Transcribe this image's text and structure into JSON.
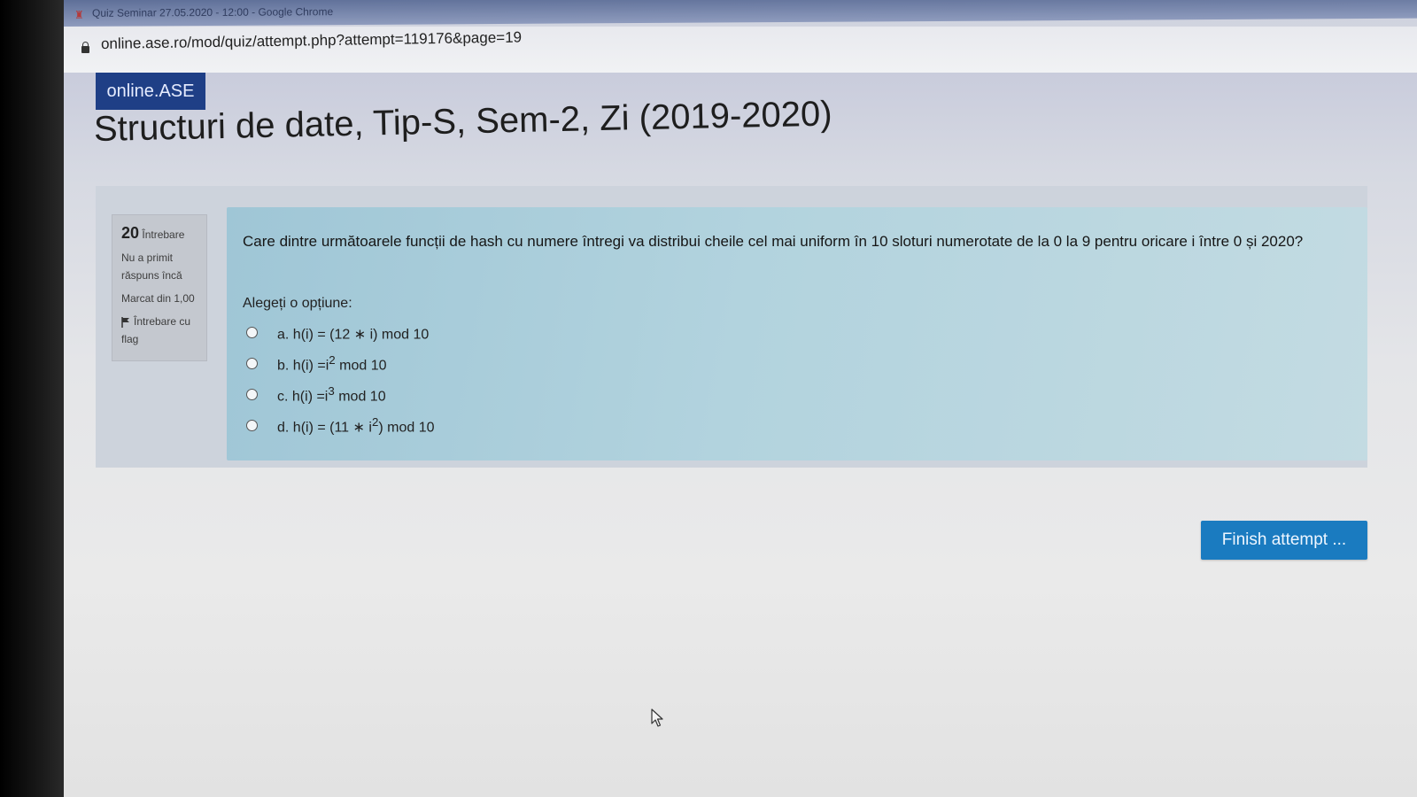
{
  "browser": {
    "window_title": "Quiz Seminar 27.05.2020 - 12:00 - Google Chrome",
    "url": "online.ase.ro/mod/quiz/attempt.php?attempt=119176&page=19"
  },
  "header": {
    "brand": "online.ASE",
    "course_title": "Structuri de date, Tip-S, Sem-2, Zi (2019-2020)"
  },
  "question_info": {
    "number": "20",
    "label": "Întrebare",
    "status": "Nu a primit răspuns încă",
    "marks": "Marcat din 1,00",
    "flag_label": "Întrebare cu flag"
  },
  "question": {
    "text": "Care dintre următoarele funcții de hash cu numere întregi va distribui cheile cel mai uniform în 10 sloturi numerotate de la 0 la 9 pentru oricare i între 0 și 2020?",
    "prompt": "Alegeți o opțiune:",
    "options": [
      {
        "letter": "a.",
        "pre": "h(i) = (12 ∗ i) mod 10",
        "sup": "",
        "post": ""
      },
      {
        "letter": "b.",
        "pre": "h(i) =i",
        "sup": "2",
        "post": " mod 10"
      },
      {
        "letter": "c.",
        "pre": "h(i) =i",
        "sup": "3",
        "post": " mod 10"
      },
      {
        "letter": "d.",
        "pre": "h(i) = (11 ∗ i",
        "sup": "2",
        "post": ") mod 10"
      }
    ]
  },
  "actions": {
    "finish_label": "Finish attempt ..."
  },
  "colors": {
    "brand_bg": "#1f3f86",
    "question_bg": "#b2d3de",
    "finish_bg": "#1a7bc0"
  }
}
